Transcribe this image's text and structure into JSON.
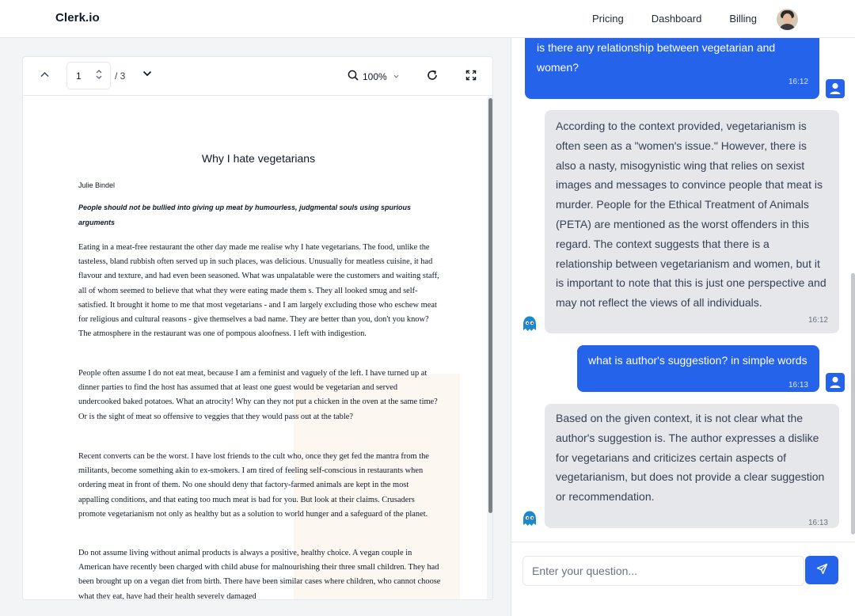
{
  "header": {
    "brand": "Clerk.io",
    "nav": [
      "Pricing",
      "Dashboard",
      "Billing"
    ]
  },
  "viewer": {
    "toolbar": {
      "page_current": "1",
      "page_total": "/ 3",
      "zoom": "100%"
    },
    "document": {
      "title": "Why I hate vegetarians",
      "author": "Julie Bindel",
      "subtitle": "People should not be bullied into giving up meat by humourless, judgmental souls using spurious arguments",
      "paragraphs": [
        "Eating in a meat-free restaurant the other day made me realise why I hate vegetarians. The food, unlike the tasteless, bland rubbish often served up in such places, was delicious. Unusually for meatless cuisine, it had flavour and texture, and had even been seasoned. What was unpalatable were the customers and waiting staff, all of whom seemed to believe that what they were eating made them s. They all looked smug and self-satisfied. It brought it home to me that most vegetarians - and I am largely excluding those who eschew meat for religious and cultural reasons - give themselves a bad name. They are better than you, don't you know? The atmosphere in the restaurant was one of pompous aloofness. I left with indigestion.",
        "People often assume I do not eat meat, because I am a feminist and vaguely of the left. I have turned up at dinner parties to find the host has assumed that at least one guest would be vegetarian and served undercooked baked potatoes. What an atrocity! Why can they not put a chicken in the oven at the same time? Or is the sight of meat so offensive to veggies that they would pass out at the table?",
        "Recent converts can be the worst. I have lost friends to the cult who, once they get fed the mantra from the militants, become something akin to ex-smokers. I am tired of feeling self-conscious in restaurants when ordering meat in front of them. No one should deny that factory-farmed animals are kept in the most appalling conditions, and that eating too much meat is bad for you. But look at their claims. Crusaders promote vegetarianism not only as healthy but as a solution to world hunger and a safeguard of the planet.",
        "Do not assume living without animal products is always a positive, healthy choice. A vegan couple in American have recently been charged with child abuse for malnourishing their three small children. They had been brought up on a vegan diet from birth. There have been similar cases where children, who cannot choose what they eat, have had their health severely damaged"
      ]
    }
  },
  "chat": {
    "messages": [
      {
        "role": "user",
        "text": "is there any relationship between vegetarian and women?",
        "time": "16:12"
      },
      {
        "role": "assistant",
        "text": "According to the context provided, vegetarianism is often seen as a \"women's issue.\" However, there is also a nasty, misogynistic wing that relies on sexist images and messages to convince people that meat is murder. People for the Ethical Treatment of Animals (PETA) are mentioned as the worst offenders in this regard. The context suggests that there is a relationship between vegetarianism and women, but it is important to note that this is just one perspective and may not reflect the views of all individuals.",
        "time": "16:12"
      },
      {
        "role": "user",
        "text": "what is author's suggestion? in simple words",
        "time": "16:13"
      },
      {
        "role": "assistant",
        "text": "Based on the given context, it is not clear what the author's suggestion is. The author expresses a dislike for vegetarians and criticizes certain aspects of vegetarianism, but does not provide a clear suggestion or recommendation.",
        "time": "16:13"
      }
    ],
    "input_placeholder": "Enter your question..."
  },
  "colors": {
    "accent": "#2563eb",
    "bot_bubble": "#e5e7eb",
    "page_background": "#f3f4f6"
  },
  "icons": {
    "toolbar": [
      "chevron-up-icon",
      "stepper-icon",
      "chevron-down-icon",
      "search-icon",
      "refresh-icon",
      "fullscreen-icon"
    ],
    "chat": [
      "user-icon",
      "bot-icon",
      "send-icon"
    ]
  }
}
